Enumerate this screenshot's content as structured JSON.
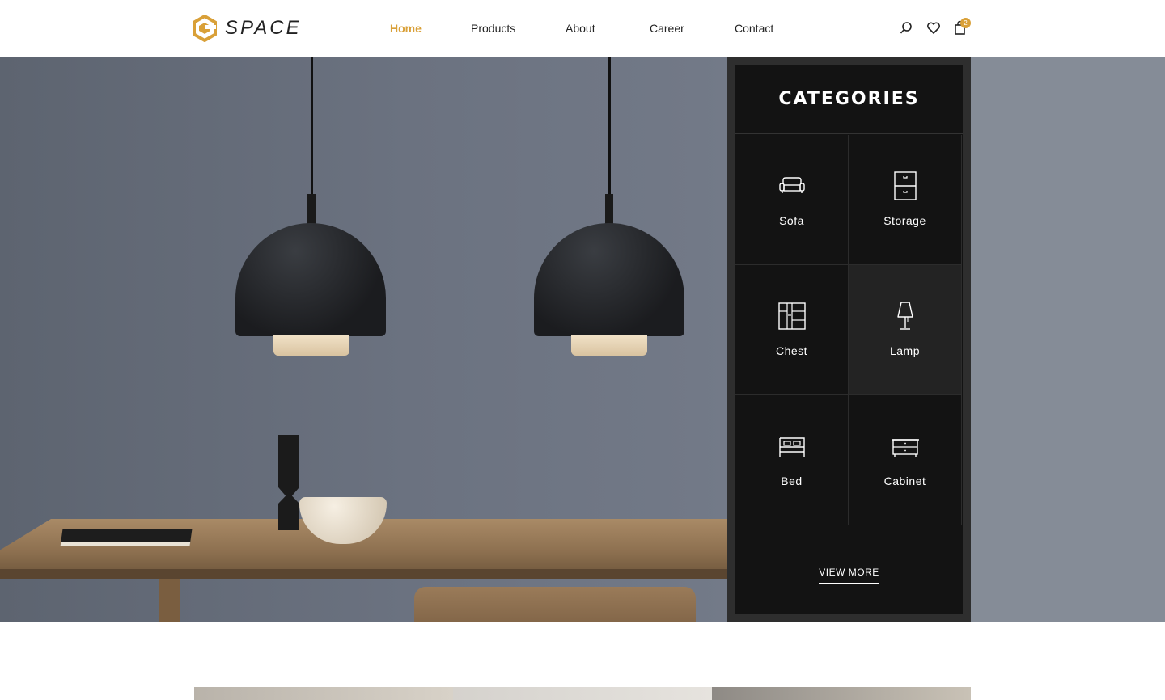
{
  "brand": {
    "name": "SPACE",
    "accent": "#d9a038"
  },
  "nav": {
    "items": [
      {
        "label": "Home",
        "active": true
      },
      {
        "label": "Products",
        "active": false
      },
      {
        "label": "About",
        "active": false
      },
      {
        "label": "Career",
        "active": false
      },
      {
        "label": "Contact",
        "active": false
      }
    ]
  },
  "header_icons": {
    "search": "search-icon",
    "wishlist": "heart-icon",
    "cart": "cart-icon",
    "cart_count": "2"
  },
  "categories": {
    "title": "CATEGORIES",
    "items": [
      {
        "label": "Sofa",
        "icon": "sofa-icon"
      },
      {
        "label": "Storage",
        "icon": "storage-icon"
      },
      {
        "label": "Chest",
        "icon": "chest-icon"
      },
      {
        "label": "Lamp",
        "icon": "lamp-icon",
        "highlighted": true
      },
      {
        "label": "Bed",
        "icon": "bed-icon"
      },
      {
        "label": "Cabinet",
        "icon": "cabinet-icon"
      }
    ],
    "view_more": "VIEW MORE"
  },
  "colors": {
    "panel_bg": "#131313",
    "panel_frame": "#2e2e2e",
    "hero_wall": "#6b7280"
  }
}
